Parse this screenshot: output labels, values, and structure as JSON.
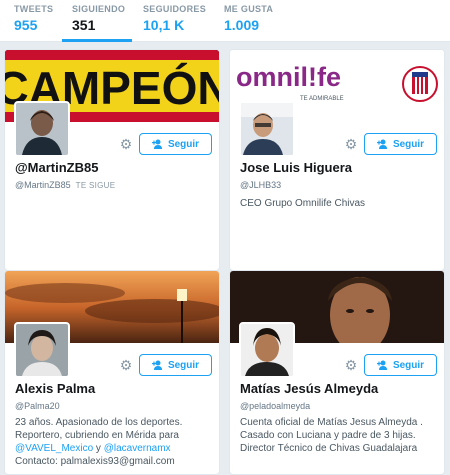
{
  "stats": [
    {
      "label": "TWEETS",
      "value": "955"
    },
    {
      "label": "SIGUIENDO",
      "value": "351"
    },
    {
      "label": "SEGUIDORES",
      "value": "10,1 K"
    },
    {
      "label": "ME GUSTA",
      "value": "1.009"
    }
  ],
  "follow_label": "Seguir",
  "banner_text": {
    "campeon": "¡CAMPEÓN!",
    "omnilife": "omnil!fe",
    "omnilife_tagline": "TE ADMIRABLE"
  },
  "cards": [
    {
      "name": "@MartinZB85",
      "handle": "@MartinZB85",
      "follows_you": "TE SIGUE",
      "bio": ""
    },
    {
      "name": "Jose Luis Higuera",
      "handle": "@JLHB33",
      "bio": "CEO Grupo Omnilife Chivas"
    },
    {
      "name": "Alexis Palma",
      "handle": "@Palma20",
      "bio_text": "23 años. Apasionado de los deportes. Reportero, cubriendo en Mérida para",
      "bio_link1": "@VAVEL_Mexico",
      "bio_and": " y ",
      "bio_link2": "@lacavernamx",
      "bio_contact": "Contacto: palmalexis93@gmail.com"
    },
    {
      "name": "Matías Jesús Almeyda",
      "handle": "@peladoalmeyda",
      "bio": "Cuenta oficial de Matías Jesus Almeyda . Casado con Luciana y padre de 3 hijas. Director Técnico de Chivas Guadalajara"
    }
  ],
  "colors": {
    "accent": "#1da1f2",
    "text": "#14171a",
    "muted": "#657786"
  }
}
